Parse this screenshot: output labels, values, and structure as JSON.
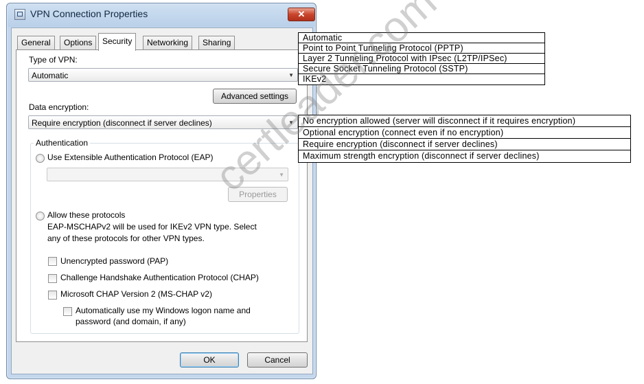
{
  "window": {
    "title": "VPN Connection Properties",
    "close_glyph": "✕"
  },
  "tabs": [
    {
      "label": "General"
    },
    {
      "label": "Options"
    },
    {
      "label": "Security",
      "active": true
    },
    {
      "label": "Networking"
    },
    {
      "label": "Sharing"
    }
  ],
  "security": {
    "vpn_type_label": "Type of VPN:",
    "vpn_type_value": "Automatic",
    "advanced_button": "Advanced settings",
    "encryption_label": "Data encryption:",
    "encryption_value": "Require encryption (disconnect if server declines)",
    "auth_group_label": "Authentication",
    "eap_radio_label": "Use Extensible Authentication Protocol (EAP)",
    "eap_combo_value": "",
    "properties_button": "Properties",
    "allow_radio_label": "Allow these protocols",
    "allow_note_line1": "EAP-MSCHAPv2 will be used for IKEv2 VPN type. Select",
    "allow_note_line2": "any of these protocols for other VPN types.",
    "checkboxes": [
      {
        "label": "Unencrypted password (PAP)",
        "checked": false
      },
      {
        "label": "Challenge Handshake Authentication Protocol (CHAP)",
        "checked": false
      },
      {
        "label": "Microsoft CHAP Version 2 (MS-CHAP v2)",
        "checked": false
      }
    ],
    "auto_logon_line1": "Automatically use my Windows logon name and",
    "auto_logon_line2": "password (and domain, if any)"
  },
  "footer": {
    "ok_button": "OK",
    "cancel_button": "Cancel"
  },
  "vpn_type_options": [
    "Automatic",
    "Point to Point Tunneling Protocol (PPTP)",
    "Layer 2 Tunneling Protocol with IPsec (L2TP/IPSec)",
    "Secure Socket Tunneling Protocol (SSTP)",
    "IKEv2"
  ],
  "encryption_options": [
    "No encryption allowed (server will disconnect if it requires encryption)",
    "Optional encryption (connect even if no encryption)",
    "Require encryption (disconnect if server declines)",
    "Maximum strength encryption (disconnect if server declines)"
  ],
  "watermark": "certleader.com",
  "colors": {
    "title_bar": "#b9d0e9",
    "close_button": "#c9452c",
    "default_button_border": "#3c7fb1"
  }
}
